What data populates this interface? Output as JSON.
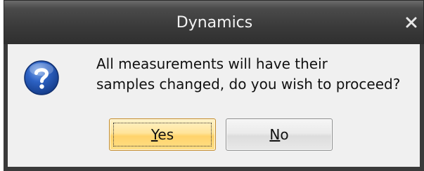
{
  "dialog": {
    "title": "Dynamics",
    "message_line1": "All measurements will have their",
    "message_line2": "samples changed, do you wish to proceed?",
    "icon": "question-icon",
    "close_icon": "close-icon"
  },
  "buttons": {
    "yes": {
      "mnemonic": "Y",
      "rest": "es"
    },
    "no": {
      "mnemonic": "N",
      "rest": "o"
    }
  },
  "colors": {
    "titlebar": "#3a3a3a",
    "body": "#f0f0f0",
    "icon_blue": "#1f4fa8",
    "yes_button": "#ffe08a"
  }
}
